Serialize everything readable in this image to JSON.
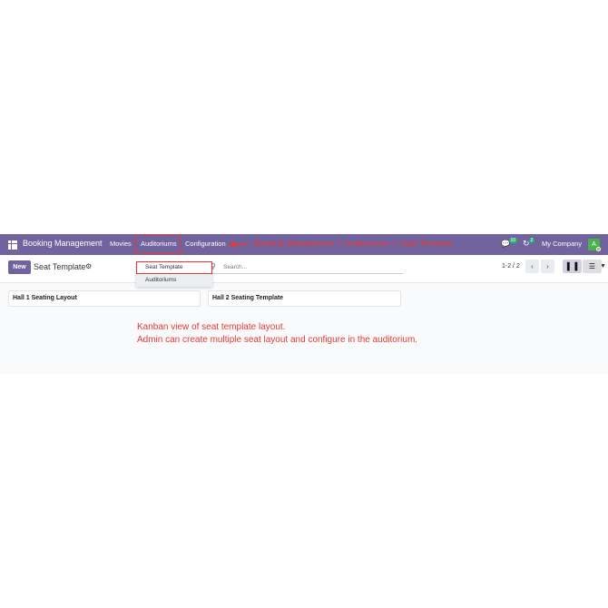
{
  "navbar": {
    "brand": "Booking Management",
    "menu": [
      "Movies",
      "Auditoriums",
      "Configuration"
    ],
    "annotation": "Booking Management -> Auditoriums -> Seat Template",
    "messages_count": "10",
    "activity_count": "2",
    "company": "My Company",
    "avatar": "A"
  },
  "control": {
    "new_label": "New",
    "title": "Seat Template",
    "search_placeholder": "Search...",
    "pager": "1-2 / 2"
  },
  "dropdown": {
    "items": [
      "Seat Template",
      "Auditoriums"
    ]
  },
  "cards": [
    "Hall 1 Seating Layout",
    "Hall 2 Seating Template"
  ],
  "notes": [
    "Kanban view of seat template layout.",
    "Admin can create multiple seat layout and configure in the auditorium."
  ],
  "colors": {
    "navbar": "#71639e",
    "annotation": "#e53935"
  },
  "icons": {
    "apps": "apps-grid-icon",
    "gear": "gear-icon",
    "search": "search-icon",
    "chat": "chat-icon",
    "activity": "activity-clock-icon",
    "kanban": "kanban-view-icon",
    "list": "list-view-icon"
  }
}
